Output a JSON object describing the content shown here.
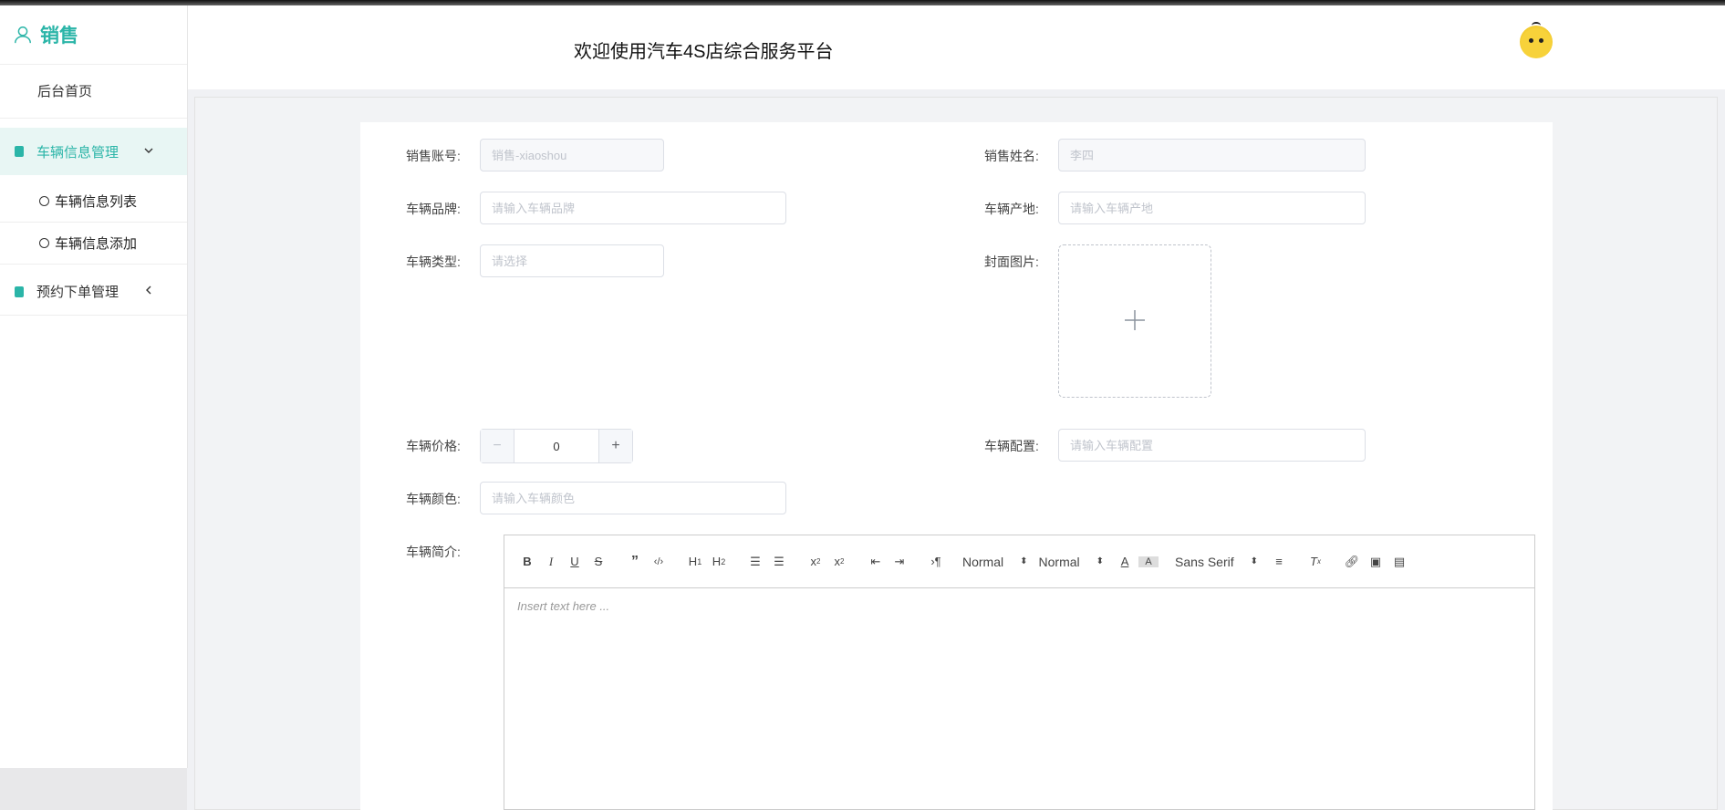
{
  "sidebar": {
    "brand": "销售",
    "items": {
      "home": "后台首页",
      "car_mgmt": "车辆信息管理",
      "car_list": "车辆信息列表",
      "car_add": "车辆信息添加",
      "order_mgmt": "预约下单管理"
    }
  },
  "header": {
    "title": "欢迎使用汽车4S店综合服务平台"
  },
  "form": {
    "account_label": "销售账号:",
    "account_value": "销售-xiaoshou",
    "name_label": "销售姓名:",
    "name_value": "李四",
    "brand_label": "车辆品牌:",
    "brand_placeholder": "请输入车辆品牌",
    "origin_label": "车辆产地:",
    "origin_placeholder": "请输入车辆产地",
    "type_label": "车辆类型:",
    "type_placeholder": "请选择",
    "cover_label": "封面图片:",
    "price_label": "车辆价格:",
    "price_value": "0",
    "config_label": "车辆配置:",
    "config_placeholder": "请输入车辆配置",
    "color_label": "车辆颜色:",
    "color_placeholder": "请输入车辆颜色",
    "intro_label": "车辆简介:"
  },
  "editor": {
    "header_picker": "Normal",
    "size_picker": "Normal",
    "font_picker": "Sans Serif",
    "placeholder": "Insert text here ..."
  },
  "colors": {
    "accent": "#2bb5a8"
  }
}
